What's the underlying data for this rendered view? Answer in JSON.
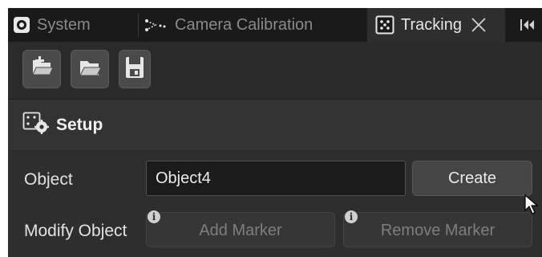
{
  "tabs": [
    {
      "label": "System",
      "icon": "system-icon",
      "active": false
    },
    {
      "label": "Camera Calibration",
      "icon": "camera-calibration-icon",
      "active": false
    },
    {
      "label": "Tracking",
      "icon": "tracking-icon",
      "active": true
    }
  ],
  "toolbar": {
    "buttons": [
      "new-object-icon",
      "open-folder-icon",
      "save-icon"
    ]
  },
  "section": {
    "title": "Setup",
    "icon": "setup-icon"
  },
  "object_row": {
    "label": "Object",
    "value": "Object4",
    "button": "Create"
  },
  "modify_row": {
    "label": "Modify Object",
    "add_button": "Add Marker",
    "remove_button": "Remove Marker",
    "info_glyph": "i"
  },
  "colors": {
    "panel_bg": "#2e2e2e",
    "tabbar_bg": "#1a1a1a",
    "input_bg": "#1b1b1b",
    "button_bg": "#454545",
    "disabled_text": "#7e7e7e"
  }
}
